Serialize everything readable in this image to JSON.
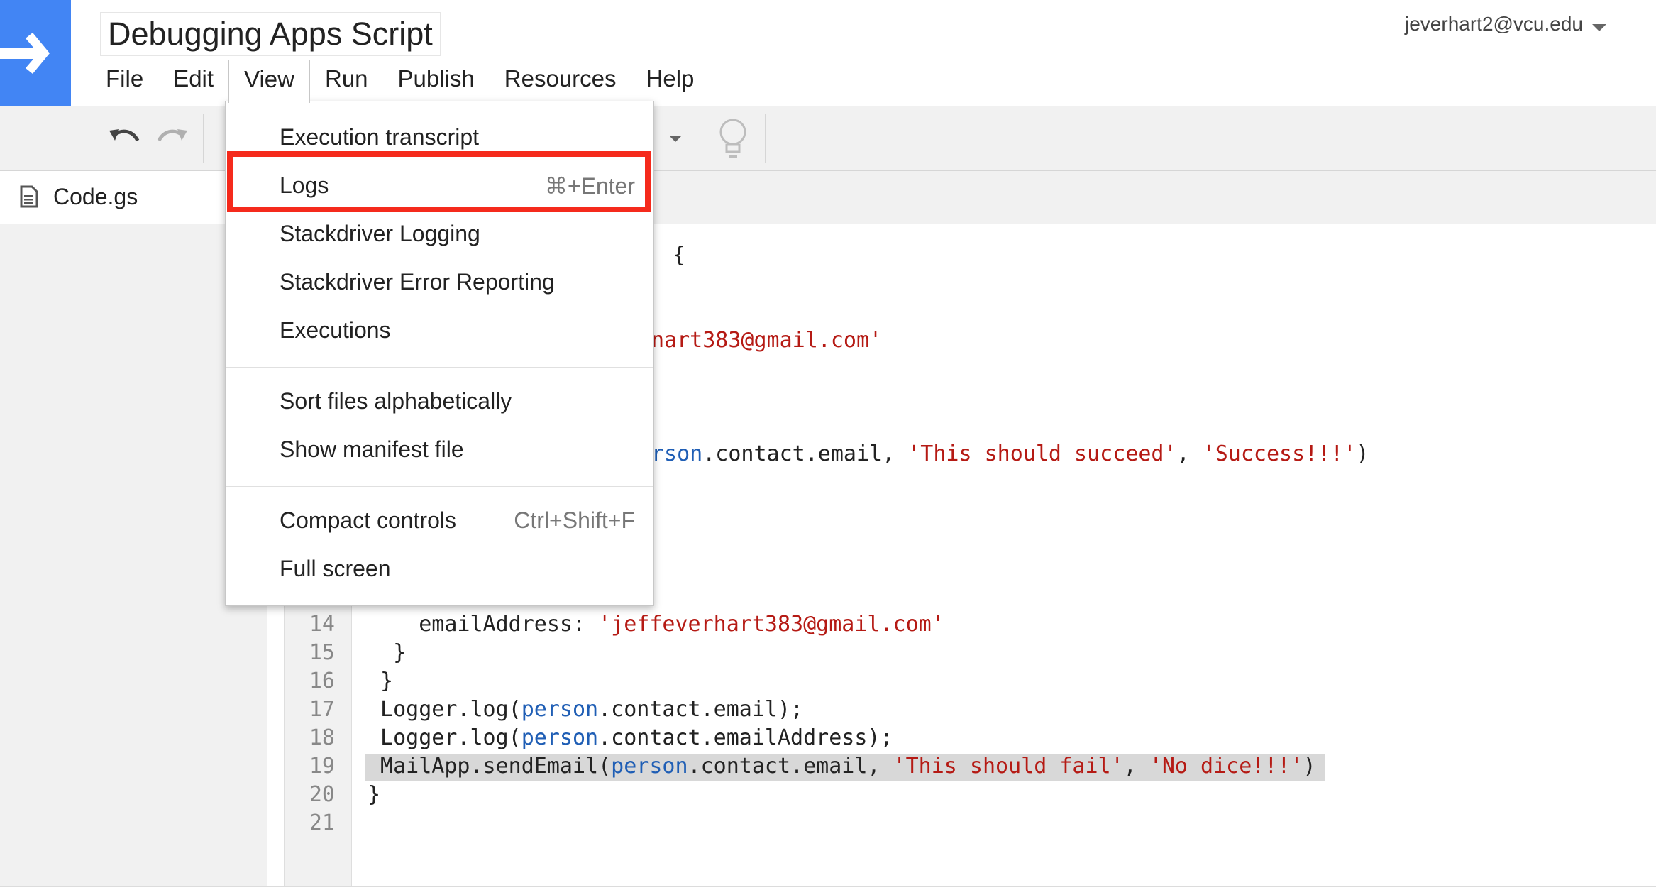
{
  "header": {
    "title": "Debugging Apps Script",
    "account": "jeverhart2@vcu.edu"
  },
  "menubar": {
    "items": [
      "File",
      "Edit",
      "View",
      "Run",
      "Publish",
      "Resources",
      "Help"
    ],
    "active": "View"
  },
  "files": [
    {
      "name": "Code.gs"
    }
  ],
  "view_menu": {
    "items": [
      {
        "label": "Execution transcript",
        "shortcut": ""
      },
      {
        "label": "Logs",
        "shortcut": "⌘+Enter"
      },
      {
        "label": "Stackdriver Logging",
        "shortcut": ""
      },
      {
        "label": "Stackdriver Error Reporting",
        "shortcut": ""
      },
      {
        "label": "Executions",
        "shortcut": ""
      },
      {
        "label": "Sort files alphabetically",
        "shortcut": ""
      },
      {
        "label": "Show manifest file",
        "shortcut": ""
      },
      {
        "label": "Compact controls",
        "shortcut": "Ctrl+Shift+F"
      },
      {
        "label": "Full screen",
        "shortcut": ""
      }
    ],
    "highlighted": "Logs"
  },
  "code": {
    "visible_partial": {
      "l1": "{",
      "l2": "nart383@gmail.com'",
      "l3_a": "rson",
      "l3_b": ".contact.email, ",
      "l3_c": "'This should succeed'",
      "l3_d": ", ",
      "l3_e": "'Success!!!'",
      "l3_f": ")"
    },
    "lines": [
      {
        "n": "14",
        "parts": [
          "    emailAddress: ",
          "'jeffeverhart383@gmail.com'"
        ]
      },
      {
        "n": "15",
        "parts": [
          "  }"
        ]
      },
      {
        "n": "16",
        "parts": [
          " }"
        ]
      },
      {
        "n": "17",
        "parts": [
          " Logger.log(",
          "person",
          ".contact.email);"
        ]
      },
      {
        "n": "18",
        "parts": [
          " Logger.log(",
          "person",
          ".contact.emailAddress);"
        ]
      },
      {
        "n": "19",
        "parts": [
          " MailApp.sendEmail(",
          "person",
          ".contact.email, ",
          "'This should fail'",
          ", ",
          "'No dice!!!'",
          ")"
        ]
      },
      {
        "n": "20",
        "parts": [
          "}"
        ]
      },
      {
        "n": "21",
        "parts": [
          ""
        ]
      }
    ]
  },
  "colors": {
    "brand_blue": "#4285f4",
    "string_red": "#b51a14",
    "keyword_blue": "#1f5eb5",
    "highlight_box": "#f52a1c"
  }
}
